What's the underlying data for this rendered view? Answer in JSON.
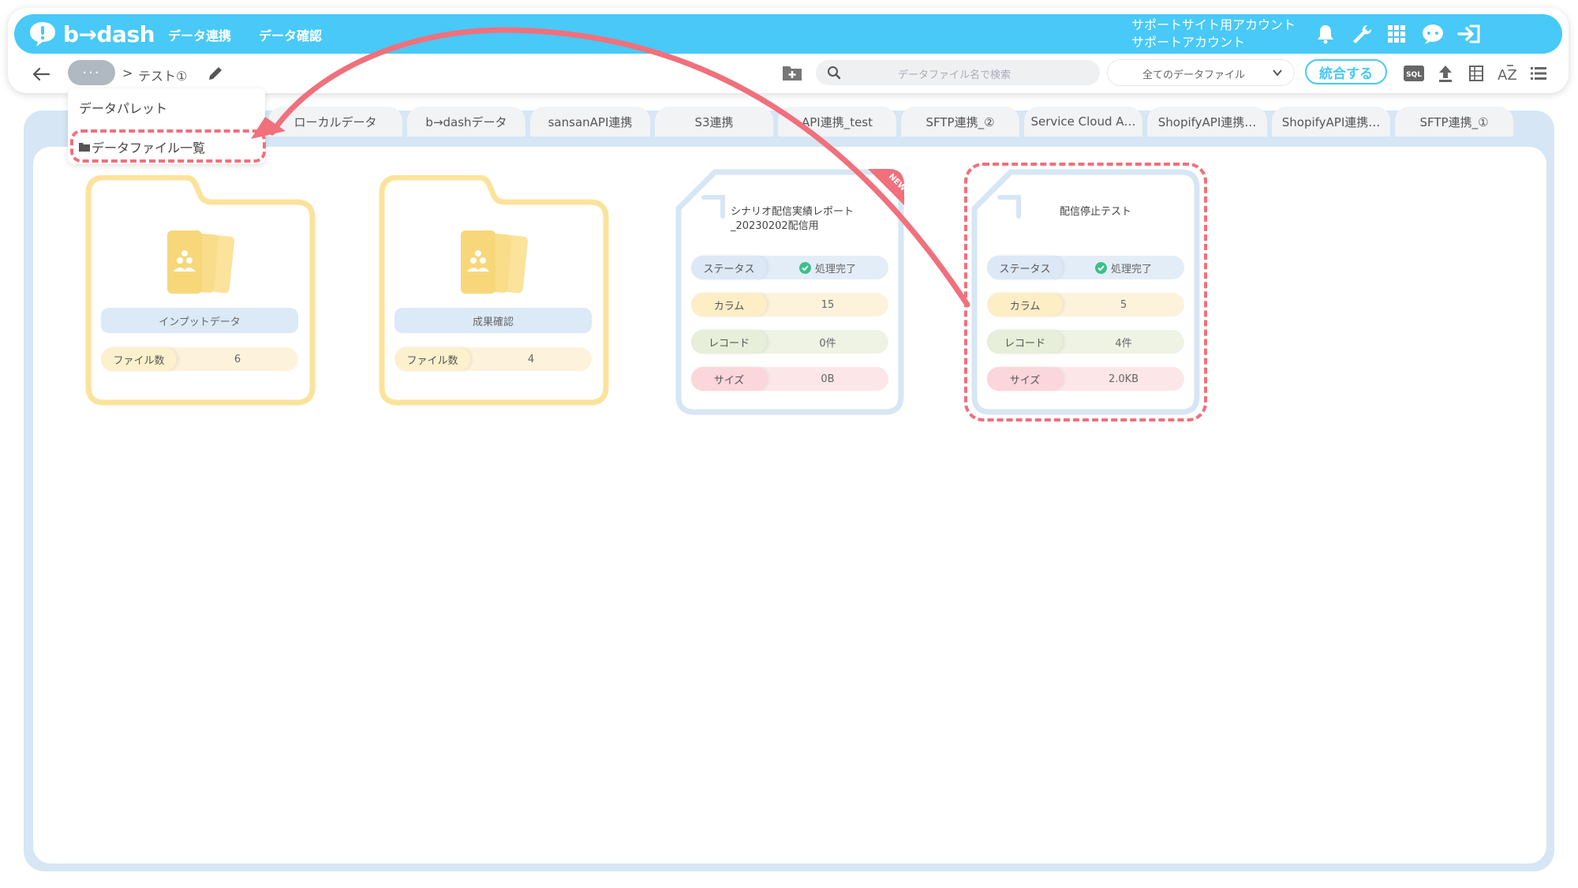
{
  "app": {
    "brand": "b→dash",
    "brand_color": "#48c9f7"
  },
  "nav": {
    "link1": "データ連携",
    "link2": "データ確認"
  },
  "account": {
    "line1": "サポートサイト用アカウント",
    "line2": "サポートアカウント"
  },
  "top_icons": [
    "bell-icon",
    "wrench-icon",
    "grid-icon",
    "chat-icon",
    "logout-icon"
  ],
  "breadcrumb": {
    "dots": "···",
    "sep": ">",
    "current": "テスト①"
  },
  "toolbar": {
    "search_placeholder": "データファイル名で検索",
    "filter_value": "全てのデータファイル",
    "merge_label": "統合する",
    "sql_label": "SQL",
    "sort_label": "AZ"
  },
  "dropdown": {
    "item1": "データパレット",
    "item2": "データファイル一覧"
  },
  "tabs": [
    {
      "label": "ローカルデータ"
    },
    {
      "label": "b→dashデータ"
    },
    {
      "label": "sansanAPI連携"
    },
    {
      "label": "S3連携"
    },
    {
      "label": "API連携_test"
    },
    {
      "label": "SFTP連携_②"
    },
    {
      "label": "Service Cloud A…"
    },
    {
      "label": "ShopifyAPI連携…"
    },
    {
      "label": "ShopifyAPI連携…"
    },
    {
      "label": "SFTP連携_①"
    }
  ],
  "folders": [
    {
      "name": "インプットデータ",
      "count_label": "ファイル数",
      "count": "6"
    },
    {
      "name": "成果確認",
      "count_label": "ファイル数",
      "count": "4"
    }
  ],
  "files": [
    {
      "title": "シナリオ配信実績レポート_20230202配信用",
      "badge": "NEW",
      "status_label": "ステータス",
      "status": "処理完了",
      "column_label": "カラム",
      "columns": "15",
      "record_label": "レコード",
      "records": "0件",
      "size_label": "サイズ",
      "size": "0B"
    },
    {
      "title": "配信停止テスト",
      "status_label": "ステータス",
      "status": "処理完了",
      "column_label": "カラム",
      "columns": "5",
      "record_label": "レコード",
      "records": "4件",
      "size_label": "サイズ",
      "size": "2.0KB"
    }
  ],
  "colors": {
    "folder_border": "#fbe39b",
    "file_border": "#d6e6f5",
    "callout": "#f0707c",
    "status_ok": "#3bbf8a"
  }
}
